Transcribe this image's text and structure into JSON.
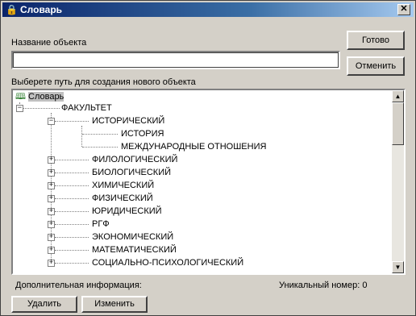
{
  "window": {
    "title": "Словарь",
    "close_glyph": "✕"
  },
  "form": {
    "name_label": "Название объекта",
    "name_value": "",
    "path_label": "Выберете путь для создания нового объекта",
    "info_label": "Дополнительная информация:",
    "unique_number": "Уникальный номер: 0"
  },
  "buttons": {
    "ok": "Готово",
    "cancel": "Отменить",
    "delete": "Удалить",
    "edit": "Изменить"
  },
  "tree": {
    "root": "Словарь",
    "faculty": "ФАКУЛЬТЕТ",
    "historical": {
      "label": "ИСТОРИЧЕСКИЙ",
      "children": [
        "ИСТОРИЯ",
        "МЕЖДУНАРОДНЫЕ ОТНОШЕНИЯ"
      ]
    },
    "collapsed": [
      "ФИЛОЛОГИЧЕСКИЙ",
      "БИОЛОГИЧЕСКИЙ",
      "ХИМИЧЕСКИЙ",
      "ФИЗИЧЕСКИЙ",
      "ЮРИДИЧЕСКИЙ",
      "РГФ",
      "ЭКОНОМИЧЕСКИЙ",
      "МАТЕМАТИЧЕСКИЙ",
      "СОЦИАЛЬНО-ПСИХОЛОГИЧЕСКИЙ"
    ],
    "expand_glyph": "+",
    "collapse_glyph": "−"
  },
  "icons": {
    "window": "lock-icon",
    "root": "book-icon",
    "scroll_up": "▲",
    "scroll_down": "▼"
  }
}
